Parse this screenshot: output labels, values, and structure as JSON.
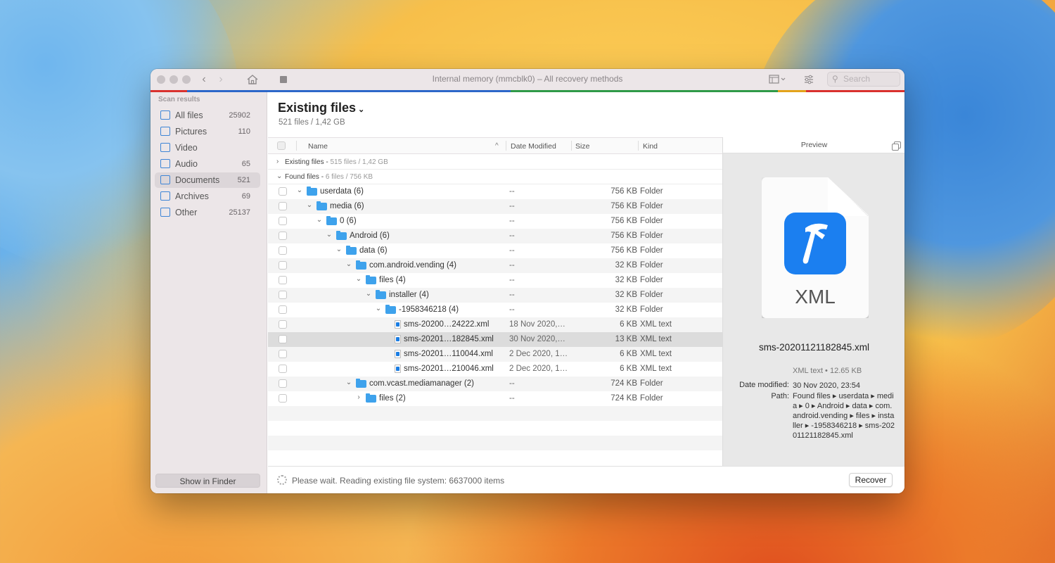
{
  "titlebar": {
    "title": "Internal memory (mmcblk0) – All recovery methods",
    "search_placeholder": "Search",
    "progress_colors": [
      "#d9312e",
      "#2c67c9",
      "#2f9a48",
      "#e3a31b",
      "#d9312e"
    ]
  },
  "sidebar": {
    "heading": "Scan results",
    "items": [
      {
        "label": "All files",
        "count": "25902",
        "icon": "all-files-icon"
      },
      {
        "label": "Pictures",
        "count": "110",
        "icon": "pictures-icon"
      },
      {
        "label": "Video",
        "count": "",
        "icon": "video-icon"
      },
      {
        "label": "Audio",
        "count": "65",
        "icon": "audio-icon"
      },
      {
        "label": "Documents",
        "count": "521",
        "icon": "documents-icon",
        "selected": true
      },
      {
        "label": "Archives",
        "count": "69",
        "icon": "archives-icon"
      },
      {
        "label": "Other",
        "count": "25137",
        "icon": "other-icon"
      }
    ],
    "show_in_finder": "Show in Finder"
  },
  "header": {
    "title": "Existing files",
    "subtitle": "521 files / 1,42 GB"
  },
  "table": {
    "columns": {
      "name": "Name",
      "date": "Date Modified",
      "size": "Size",
      "kind": "Kind"
    },
    "groups": [
      {
        "label": "Existing files",
        "meta": "515 files / 1,42 GB",
        "expanded": false
      },
      {
        "label": "Found files",
        "meta": "6 files / 756 KB",
        "expanded": true
      }
    ],
    "rows": [
      {
        "name": "userdata (6)",
        "date": "--",
        "size": "756 KB",
        "kind": "Folder",
        "type": "folder",
        "depth": 0,
        "chev": "v"
      },
      {
        "name": "media (6)",
        "date": "--",
        "size": "756 KB",
        "kind": "Folder",
        "type": "folder",
        "depth": 1,
        "chev": "v"
      },
      {
        "name": "0 (6)",
        "date": "--",
        "size": "756 KB",
        "kind": "Folder",
        "type": "folder",
        "depth": 2,
        "chev": "v"
      },
      {
        "name": "Android (6)",
        "date": "--",
        "size": "756 KB",
        "kind": "Folder",
        "type": "folder",
        "depth": 3,
        "chev": "v"
      },
      {
        "name": "data (6)",
        "date": "--",
        "size": "756 KB",
        "kind": "Folder",
        "type": "folder",
        "depth": 4,
        "chev": "v"
      },
      {
        "name": "com.android.vending (4)",
        "date": "--",
        "size": "32 KB",
        "kind": "Folder",
        "type": "folder",
        "depth": 5,
        "chev": "v"
      },
      {
        "name": "files (4)",
        "date": "--",
        "size": "32 KB",
        "kind": "Folder",
        "type": "folder",
        "depth": 6,
        "chev": "v"
      },
      {
        "name": "installer (4)",
        "date": "--",
        "size": "32 KB",
        "kind": "Folder",
        "type": "folder",
        "depth": 7,
        "chev": "v"
      },
      {
        "name": "-1958346218 (4)",
        "date": "--",
        "size": "32 KB",
        "kind": "Folder",
        "type": "folder",
        "depth": 8,
        "chev": "v"
      },
      {
        "name": "sms-20200…24222.xml",
        "date": "18 Nov 2020,…",
        "size": "6 KB",
        "kind": "XML text",
        "type": "xml",
        "depth": 9,
        "chev": ""
      },
      {
        "name": "sms-20201…182845.xml",
        "date": "30 Nov 2020,…",
        "size": "13 KB",
        "kind": "XML text",
        "type": "xml",
        "depth": 9,
        "chev": "",
        "selected": true
      },
      {
        "name": "sms-20201…110044.xml",
        "date": "2 Dec 2020, 1…",
        "size": "6 KB",
        "kind": "XML text",
        "type": "xml",
        "depth": 9,
        "chev": ""
      },
      {
        "name": "sms-20201…210046.xml",
        "date": "2 Dec 2020, 1…",
        "size": "6 KB",
        "kind": "XML text",
        "type": "xml",
        "depth": 9,
        "chev": ""
      },
      {
        "name": "com.vcast.mediamanager (2)",
        "date": "--",
        "size": "724 KB",
        "kind": "Folder",
        "type": "folder",
        "depth": 5,
        "chev": "v"
      },
      {
        "name": "files (2)",
        "date": "--",
        "size": "724 KB",
        "kind": "Folder",
        "type": "folder",
        "depth": 6,
        "chev": ">"
      }
    ]
  },
  "preview": {
    "header": "Preview",
    "doc_label": "XML",
    "file_name": "sms-20201121182845.xml",
    "kind_size": "XML text • 12.65 KB",
    "date_label": "Date modified:",
    "date_value": "30 Nov 2020, 23:54",
    "path_label": "Path:",
    "path_value": "Found files ▸ userdata ▸ media ▸ 0 ▸ Android ▸ data ▸ com.android.vending ▸ files ▸ installer ▸ -1958346218 ▸ sms-20201121182845.xml"
  },
  "footer": {
    "status": "Please wait. Reading existing file system: 6637000 items",
    "recover_label": "Recover"
  }
}
